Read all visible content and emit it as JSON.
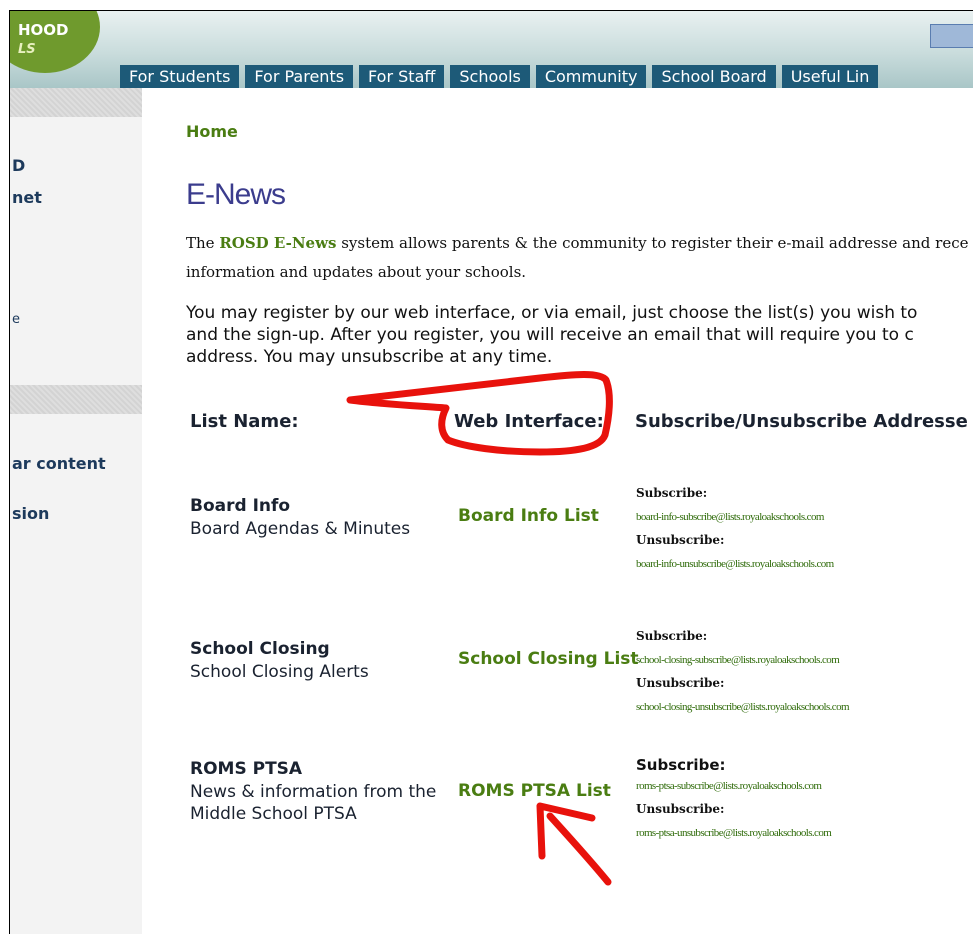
{
  "header": {
    "logo_line1": "HOOD",
    "logo_line2": "LS",
    "nav": [
      "For Students",
      "For Parents",
      "For Staff",
      "Schools",
      "Community",
      "School Board",
      "Useful Lin"
    ]
  },
  "sidebar": {
    "fragments": [
      "D",
      "net",
      "e",
      "ar content",
      "sion"
    ]
  },
  "breadcrumb": "Home",
  "page_title": "E-News",
  "intro": {
    "before": "The ",
    "link": "ROSD E-News",
    "after_line1": " system allows parents & the community to register their e-mail addresse and rece",
    "line2": "information and updates about your schools."
  },
  "instructions": {
    "line1": "You may register by our web interface, or via email, just choose the list(s) you wish to",
    "line2": "and the sign-up.  After you register, you will receive an email that will require you to c",
    "line3": "address.  You may unsubscribe at any time."
  },
  "table": {
    "headers": [
      "List Name:",
      "Web Interface:",
      "Subscribe/Unsubscribe Addresse"
    ],
    "subscribe_label": "Subscribe:",
    "unsubscribe_label": "Unsubscribe:",
    "rows": [
      {
        "name": "Board Info",
        "desc": [
          "Board Agendas & Minutes"
        ],
        "link": "Board Info List",
        "subscribe": "board-info-subscribe@lists.royaloakschools.com",
        "unsubscribe": "board-info-unsubscribe@lists.royaloakschools.com"
      },
      {
        "name": "School Closing",
        "desc": [
          "School Closing Alerts"
        ],
        "link": "School Closing List",
        "subscribe": "school-closing-subscribe@lists.royaloakschools.com",
        "unsubscribe": "school-closing-unsubscribe@lists.royaloakschools.com"
      },
      {
        "name": "ROMS PTSA",
        "desc": [
          "News & information from the",
          "Middle School PTSA"
        ],
        "link": "ROMS PTSA List",
        "subscribe": "roms-ptsa-subscribe@lists.royaloakschools.com",
        "unsubscribe": "roms-ptsa-unsubscribe@lists.royaloakschools.com"
      }
    ]
  },
  "colors": {
    "nav_bg": "#1d5a78",
    "link_green": "#4a7d12",
    "title_blue": "#3b3c8d",
    "annotation_red": "#e8120c"
  }
}
